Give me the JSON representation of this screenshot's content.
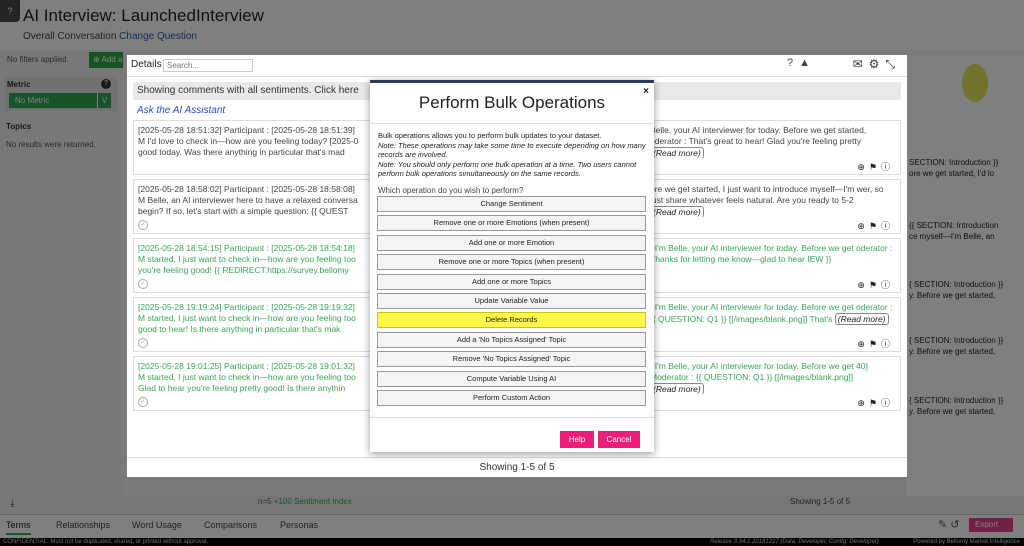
{
  "app": {
    "corner_label": "?",
    "title": "AI Interview: LaunchedInterview",
    "subtitle": "Overall Conversation",
    "subtitle_link": "Change Question"
  },
  "left_panel": {
    "filters": "No filters applied.",
    "add_label": "Add a",
    "metric_label": "Metric",
    "metric_value": "No Metric",
    "topics_label": "Topics",
    "no_results": "No results were returned."
  },
  "right_panel": {
    "rows": [
      "SECTION: Introduction }}",
      "ore we get started, I'd lo",
      "{{ SECTION: Introduction",
      "ce myself—I'm Belle, an",
      "{ SECTION: Introduction }}",
      "y. Before we get started,",
      "{ SECTION: Introduction }}",
      "y. Before we get started,",
      "{ SECTION: Introduction }}",
      "y. Before we get started,"
    ],
    "showing": "Showing 1-5 of 5"
  },
  "index": {
    "prefix": "n=5",
    "value": "+100 Sentiment Index"
  },
  "details": {
    "title": "Details",
    "search_placeholder": "Search...",
    "notice": "Showing comments with all sentiments. Click here",
    "ask_ai": "Ask the AI Assistant",
    "read_more": "(Read more)",
    "cards": [
      {
        "left": "[2025-05-28 18:51:32] Participant : [2025-05-28 18:51:39] M I'd love to check in—how are you feeling today? [2025-0 good today. Was there anything in particular that's mad",
        "right": "Belle, your AI interviewer for today. Before we get started, oderator : That's great to hear! Glad you're feeling pretty"
      },
      {
        "left": "[2025-05-28 18:58:02] Participant : [2025-05-28 18:58:08] M Belle, an AI interviewer here to have a relaxed conversa begin? If so, let's start with a simple question: {{ QUEST",
        "right": "ore we get started, I just want to introduce myself—I'm wer, so just share whatever feels natural. Are you ready to 5-2"
      },
      {
        "left": "[2025-05-28 18:54:15] Participant : [2025-05-28 18:54:18] M started, I just want to check in—how are you feeling too you're feeling good! {{ REDIRECT:https://survey.bellomy",
        "right": "! I'm Belle, your AI interviewer for today. Before we get oderator : Thanks for letting me know—glad to hear IEW }}"
      },
      {
        "left": "[2025-05-28 19:19:24] Participant : [2025-05-28 19:19:32] M started, I just want to check in—how are you feeling too good to hear! Is there anything in particular that's mak",
        "right": "! I'm Belle, your AI interviewer for today. Before we get oderator : {{ QUESTION: Q1 }} [[/images/blank.png]] That's"
      },
      {
        "left": "[2025-05-28 19:01:25] Participant : [2025-05-28 19:01:32] M started, I just want to check in—how are you feeling too Glad to hear you're feeling pretty good! Is there anythin",
        "right": "! I'm Belle, your AI interviewer for today. Before we get 40] Moderator : {{ QUESTION: Q1 }} [[/images/blank.png]]"
      }
    ],
    "footer": "Showing 1-5 of 5"
  },
  "bulk": {
    "title": "Perform Bulk Operations",
    "close": "×",
    "desc": "Bulk operations allows you to perform bulk updates to your dataset.",
    "note1": "Note: These operations may take some time to execute depending on how many records are involved.",
    "note2": "Note: You should only perform one bulk operation at a time. Two users cannot perform bulk operations simultaneously on the same records.",
    "question": "Which operation do you wish to perform?",
    "operations": [
      "Change Sentiment",
      "Remove one or more Emotions (when present)",
      "Add one or more Emotion",
      "Remove one or more Topics (when present)",
      "Add one or more Topics",
      "Update Variable Value",
      "Delete Records",
      "Add a 'No Topics Assigned' Topic",
      "Remove 'No Topics Assigned' Topic",
      "Compute Variable Using AI",
      "Perform Custom Action"
    ],
    "highlighted_index": 6,
    "help_label": "Help",
    "cancel_label": "Cancel"
  },
  "tabs": [
    "Terms",
    "Relationships",
    "Word Usage",
    "Comparisons",
    "Personas"
  ],
  "export_label": "Export",
  "footer": {
    "left": "CONFIDENTIAL: Must not be duplicated, shared, or printed without approval.",
    "release": "Release 3.34.1.20181227 (Data: Developer, Config: Developer)",
    "powered": "Powered by Bellomy Market Intelligence"
  },
  "colors": {
    "accent_green": "#2fa84f",
    "pink": "#ec1e7a",
    "highlight": "#fff64a",
    "modal_top": "#2b3a55"
  }
}
